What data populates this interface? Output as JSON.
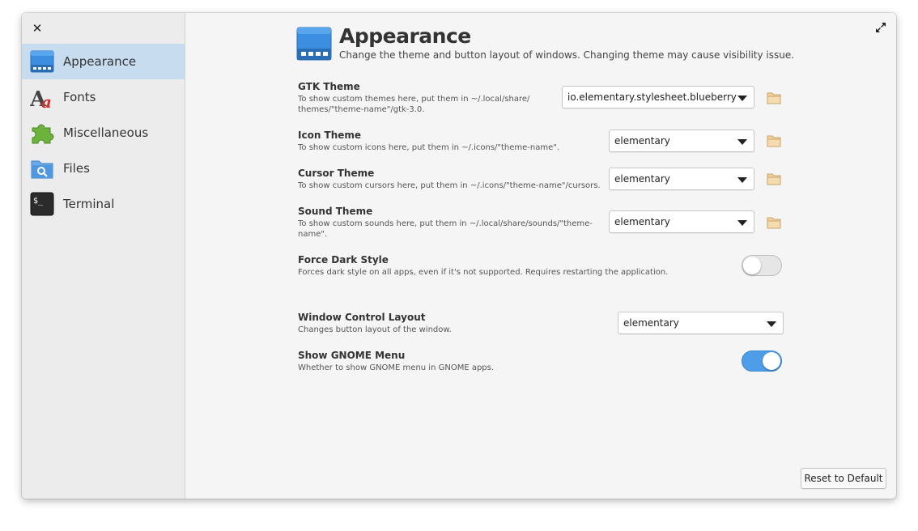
{
  "window": {
    "close_glyph": "✕"
  },
  "sidebar": {
    "items": [
      {
        "label": "Appearance",
        "icon": "appearance-icon",
        "active": true
      },
      {
        "label": "Fonts",
        "icon": "fonts-icon",
        "active": false
      },
      {
        "label": "Miscellaneous",
        "icon": "puzzle-icon",
        "active": false
      },
      {
        "label": "Files",
        "icon": "files-icon",
        "active": false
      },
      {
        "label": "Terminal",
        "icon": "terminal-icon",
        "active": false
      }
    ]
  },
  "header": {
    "title": "Appearance",
    "subtitle": "Change the theme and button layout of windows. Changing theme may cause visibility issue."
  },
  "settings": {
    "gtk_theme": {
      "title": "GTK Theme",
      "desc": "To show custom themes here, put them in ~/.local/share/\nthemes/\"theme-name\"/gtk-3.0.",
      "value": "io.elementary.stylesheet.blueberry"
    },
    "icon_theme": {
      "title": "Icon Theme",
      "desc": "To show custom icons here, put them in ~/.icons/\"theme-name\".",
      "value": "elementary"
    },
    "cursor_theme": {
      "title": "Cursor Theme",
      "desc": "To show custom cursors here, put them in ~/.icons/\"theme-name\"/cursors.",
      "value": "elementary"
    },
    "sound_theme": {
      "title": "Sound Theme",
      "desc": "To show custom sounds here, put them in ~/.local/share/sounds/\"theme-\nname\".",
      "value": "elementary"
    },
    "force_dark": {
      "title": "Force Dark Style",
      "desc": "Forces dark style on all apps, even if it's not supported. Requires restarting the application.",
      "enabled": false
    },
    "window_layout": {
      "title": "Window Control Layout",
      "desc": "Changes button layout of the window.",
      "value": "elementary"
    },
    "gnome_menu": {
      "title": "Show GNOME Menu",
      "desc": "Whether to show GNOME menu in GNOME apps.",
      "enabled": true
    }
  },
  "footer": {
    "reset_label": "Reset to Default"
  },
  "colors": {
    "accent": "#4e9de8",
    "sidebar_active": "#c8dcf0"
  }
}
